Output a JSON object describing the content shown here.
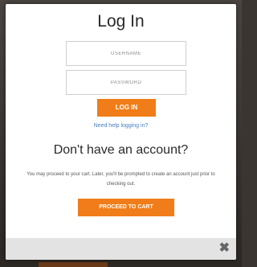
{
  "modal": {
    "title": "Log In",
    "username_placeholder": "USERNAME",
    "password_placeholder": "PASSWORD",
    "login_button": "LOG IN",
    "help_link": "Need help logging in?",
    "no_account_heading": "Don't have an account?",
    "description": "You may proceed to your cart. Later, you'll be prompted to create an account just prior to checking out.",
    "proceed_button": "PROCEED TO CART",
    "close_glyph": "✖"
  },
  "colors": {
    "accent": "#f07d19",
    "link": "#4a7fc1",
    "footer": "#e3e3e3"
  },
  "icons": {
    "close": "close-icon"
  }
}
